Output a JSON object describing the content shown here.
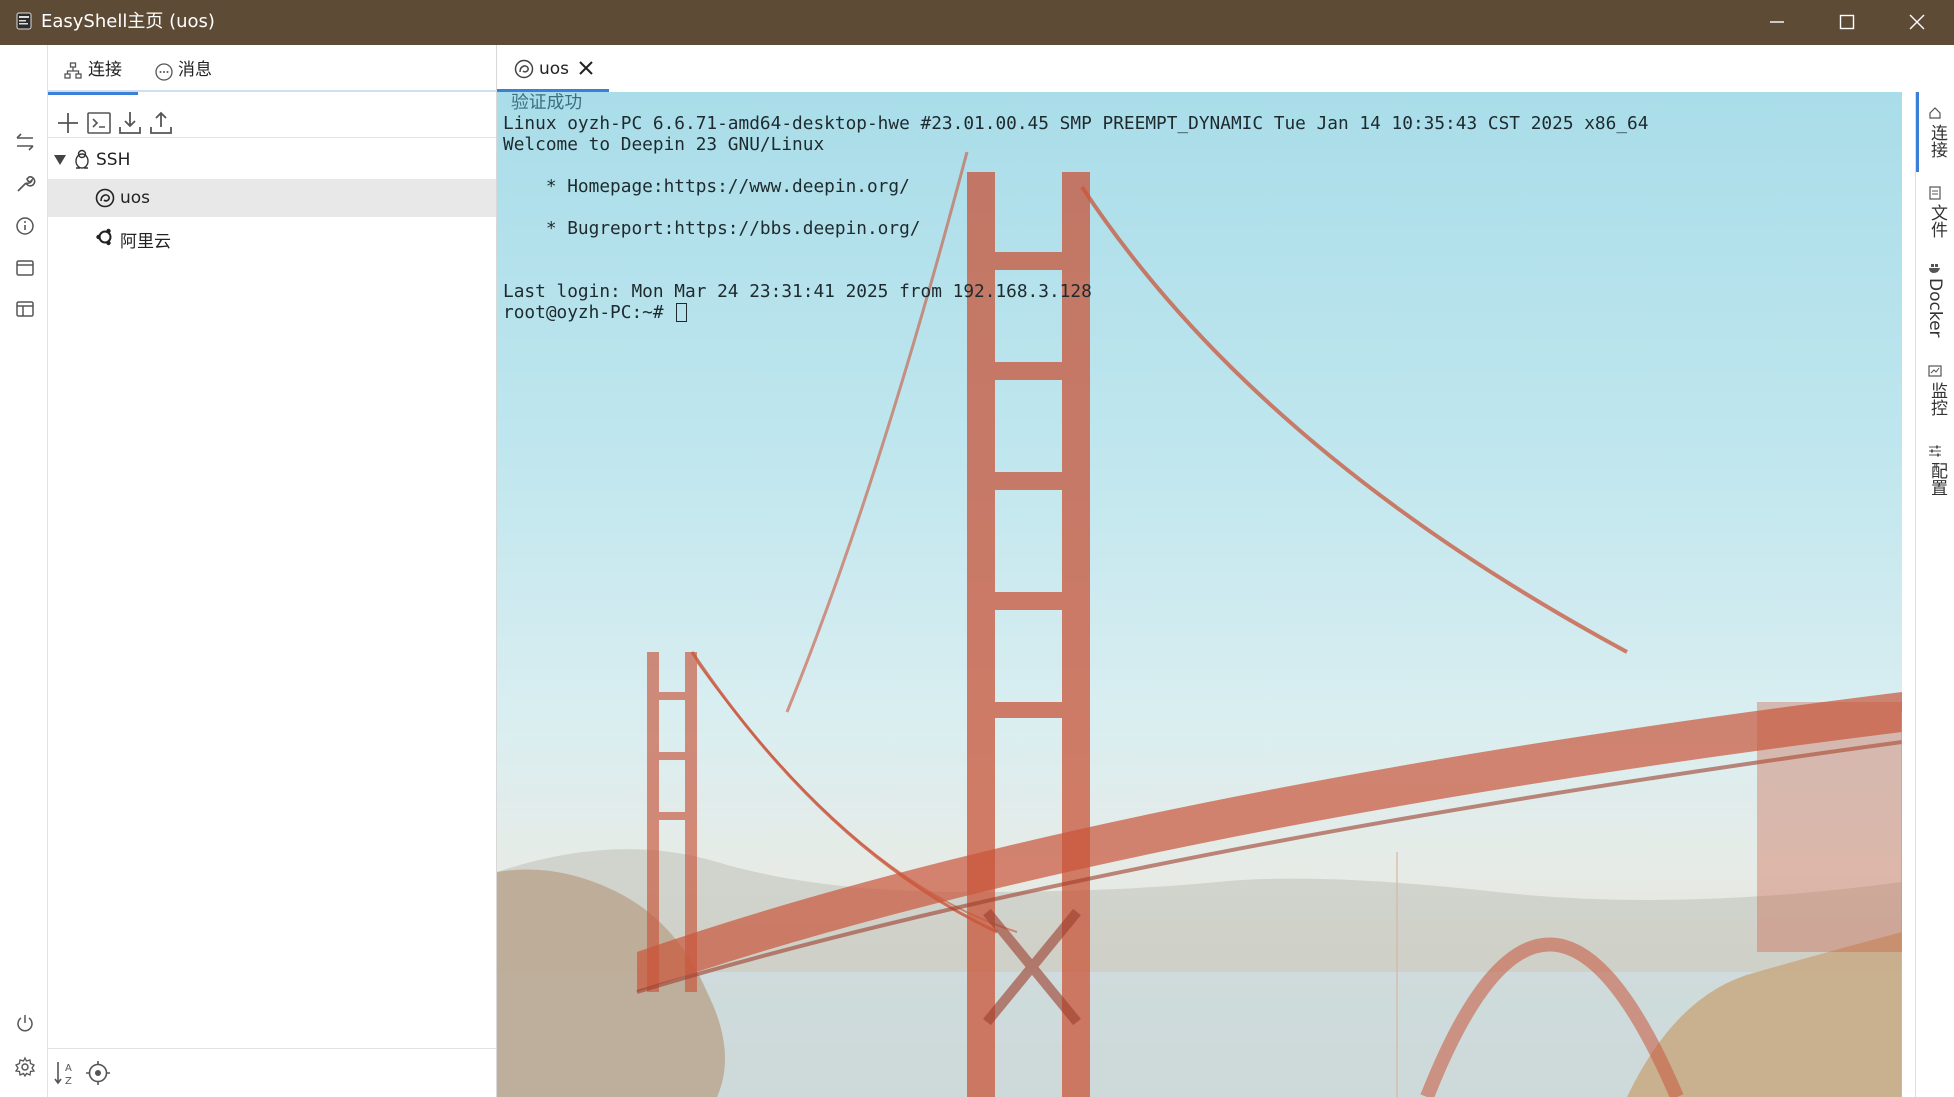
{
  "window": {
    "title": "EasyShell主页 (uos)",
    "controls": [
      "minimize",
      "maximize",
      "close"
    ]
  },
  "left_strip": {
    "icons": [
      "transfer-icon",
      "wrench-icon",
      "info-icon",
      "window-icon",
      "layout-icon",
      "power-icon",
      "gear-icon"
    ]
  },
  "sidebar": {
    "tabs": [
      {
        "label": "连接",
        "icon": "hierarchy-icon",
        "active": true
      },
      {
        "label": "消息",
        "icon": "chat-icon",
        "active": false
      }
    ],
    "toolbar": [
      "add-icon",
      "terminal-icon",
      "import-icon",
      "export-icon"
    ],
    "tree": {
      "group": {
        "label": "SSH",
        "icon": "linux-icon",
        "expanded": true
      },
      "items": [
        {
          "label": "uos",
          "icon": "deepin-icon",
          "selected": true
        },
        {
          "label": "阿里云",
          "icon": "ubuntu-icon",
          "selected": false
        }
      ]
    },
    "bottom_tools": [
      "sort-az-icon",
      "locate-icon"
    ]
  },
  "terminal_tabs": [
    {
      "label": "uos",
      "icon": "deepin-icon",
      "closable": true,
      "active": true
    }
  ],
  "terminal": {
    "lines": [
      "验证成功",
      "Linux oyzh-PC 6.6.71-amd64-desktop-hwe #23.01.00.45 SMP PREEMPT_DYNAMIC Tue Jan 14 10:35:43 CST 2025 x86_64",
      "Welcome to Deepin 23 GNU/Linux",
      "",
      "    * Homepage:https://www.deepin.org/",
      "",
      "    * Bugreport:https://bbs.deepin.org/",
      "",
      "",
      "Last login: Mon Mar 24 23:31:41 2025 from 192.168.3.128"
    ],
    "prompt": "root@oyzh-PC:~# ",
    "background": "golden-gate-bridge"
  },
  "right_panel": {
    "tabs": [
      "连接",
      "文件",
      "Docker",
      "监控",
      "配置"
    ],
    "active": "连接"
  },
  "colors": {
    "titlebar": "#5e4b35",
    "accent": "#3c7fd6",
    "selected_row": "#e8e8e8",
    "bridge": "#c9553a"
  }
}
